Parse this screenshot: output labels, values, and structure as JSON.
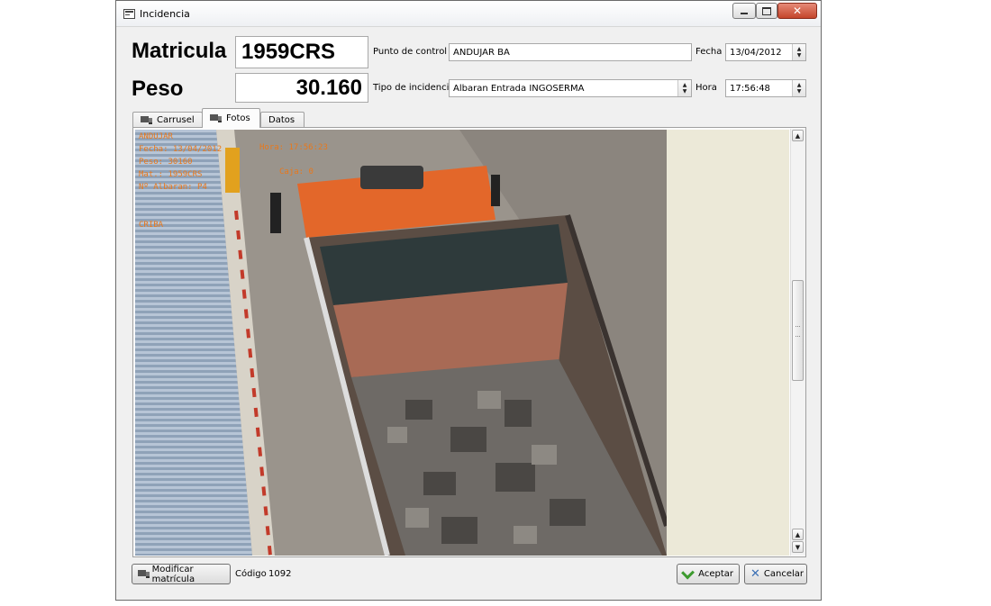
{
  "window": {
    "title": "Incidencia",
    "close_glyph": "✕",
    "icon": "app-form-icon"
  },
  "header": {
    "matricula_label": "Matricula",
    "matricula_value": "1959CRS",
    "peso_label": "Peso",
    "peso_value": "30.160",
    "punto_label": "Punto de control",
    "punto_value": "ANDUJAR BA",
    "tipo_label": "Tipo de incidencia",
    "tipo_value": "Albaran Entrada INGOSERMA",
    "fecha_label": "Fecha",
    "fecha_value": "13/04/2012",
    "hora_label": "Hora",
    "hora_value": "17:56:48"
  },
  "tabs": [
    {
      "label": "Carrusel",
      "icon": "truck-icon"
    },
    {
      "label": "Fotos",
      "icon": "truck-icon",
      "active": true
    },
    {
      "label": "Datos"
    }
  ],
  "photo": {
    "overlay_lines": "ANDUJAR\nFecha: 13/04/2012\nPeso: 30160\nMat.: 1959CRS\nNº Albaran: P4\n\n\nCRIBA",
    "overlay_hora": "Hora: 17:56:23",
    "overlay_caja": "Caja: 0"
  },
  "footer": {
    "modificar_label": "Modificar matrícula",
    "codigo_label": "Código",
    "codigo_value": "1092",
    "aceptar_label": "Aceptar",
    "cancelar_label": "Cancelar"
  },
  "colors": {
    "overlay_text": "#e8781c",
    "accept_icon": "#3c9a2e",
    "cancel_icon": "#3a6fb4"
  }
}
